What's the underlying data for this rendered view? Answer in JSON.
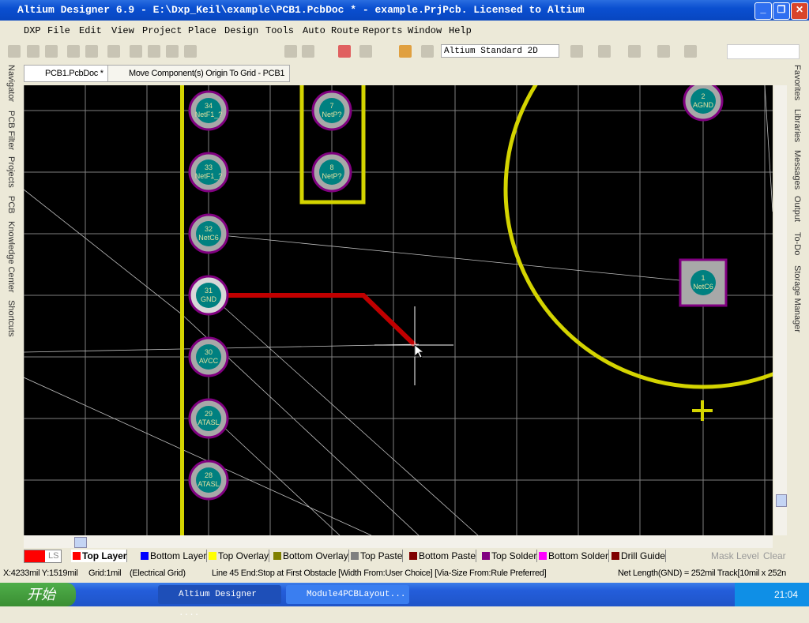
{
  "window": {
    "title": "Altium Designer 6.9 - E:\\Dxp_Keil\\example\\PCB1.PcbDoc * - example.PrjPcb. Licensed to Altium"
  },
  "menu": [
    "DXP",
    "File",
    "Edit",
    "View",
    "Project",
    "Place",
    "Design",
    "Tools",
    "Auto Route",
    "Reports",
    "Window",
    "Help"
  ],
  "toolbar": {
    "view_mode": "Altium Standard 2D"
  },
  "tabs": [
    {
      "label": "PCB1.PcbDoc *"
    },
    {
      "label": "Move Component(s) Origin To Grid - PCB1"
    }
  ],
  "left_panels": [
    "Navigator",
    "PCB Filter",
    "Projects",
    "PCB",
    "Knowledge Center",
    "Shortcuts"
  ],
  "right_panels": [
    "Favorites",
    "Libraries",
    "Messages",
    "Output",
    "To-Do",
    "Storage Manager"
  ],
  "pads": [
    {
      "num": "34",
      "net": "NetF1_?"
    },
    {
      "num": "33",
      "net": "NetF1_?"
    },
    {
      "num": "32",
      "net": "NetC6"
    },
    {
      "num": "31",
      "net": "GND"
    },
    {
      "num": "30",
      "net": "AVCC"
    },
    {
      "num": "29",
      "net": "ATASL"
    },
    {
      "num": "28",
      "net": "ATASL"
    },
    {
      "num": "7",
      "net": "NetP?"
    },
    {
      "num": "8",
      "net": "NetP?"
    },
    {
      "num": "2",
      "net": "AGND"
    },
    {
      "num": "1",
      "net": "NetC6"
    }
  ],
  "colors": {
    "board": "#000000",
    "track": "#c00000",
    "overlay": "#d4d400",
    "pad": "#a8a8a8",
    "pad_hole": "#008080",
    "pad_ring": "#800080"
  },
  "layers": {
    "current_ls": "LS",
    "items": [
      {
        "label": "Top Layer",
        "color": "#ff0000"
      },
      {
        "label": "Bottom Layer",
        "color": "#0000ff"
      },
      {
        "label": "Top Overlay",
        "color": "#ffff00"
      },
      {
        "label": "Bottom Overlay",
        "color": "#808000"
      },
      {
        "label": "Top Paste",
        "color": "#808080"
      },
      {
        "label": "Bottom Paste",
        "color": "#800000"
      },
      {
        "label": "Top Solder",
        "color": "#800080"
      },
      {
        "label": "Bottom Solder",
        "color": "#ff00ff"
      },
      {
        "label": "Drill Guide",
        "color": "#800000"
      }
    ],
    "mask_level": "Mask Level",
    "clear": "Clear"
  },
  "status": {
    "coords": "X:4233mil Y:1519mil",
    "grid": "Grid:1mil",
    "grid_type": "(Electrical Grid)",
    "command": "Line 45 End:Stop at First Obstacle  [Width From:User Choice] [Via-Size From:Rule Preferred]",
    "net": "Net Length(GND) = 252mil  Track[10mil x 252n"
  },
  "taskbar": {
    "start": "开始",
    "tasks": [
      "Altium Designer ....",
      "Module4PCBLayout..."
    ],
    "clock": "21:04"
  }
}
